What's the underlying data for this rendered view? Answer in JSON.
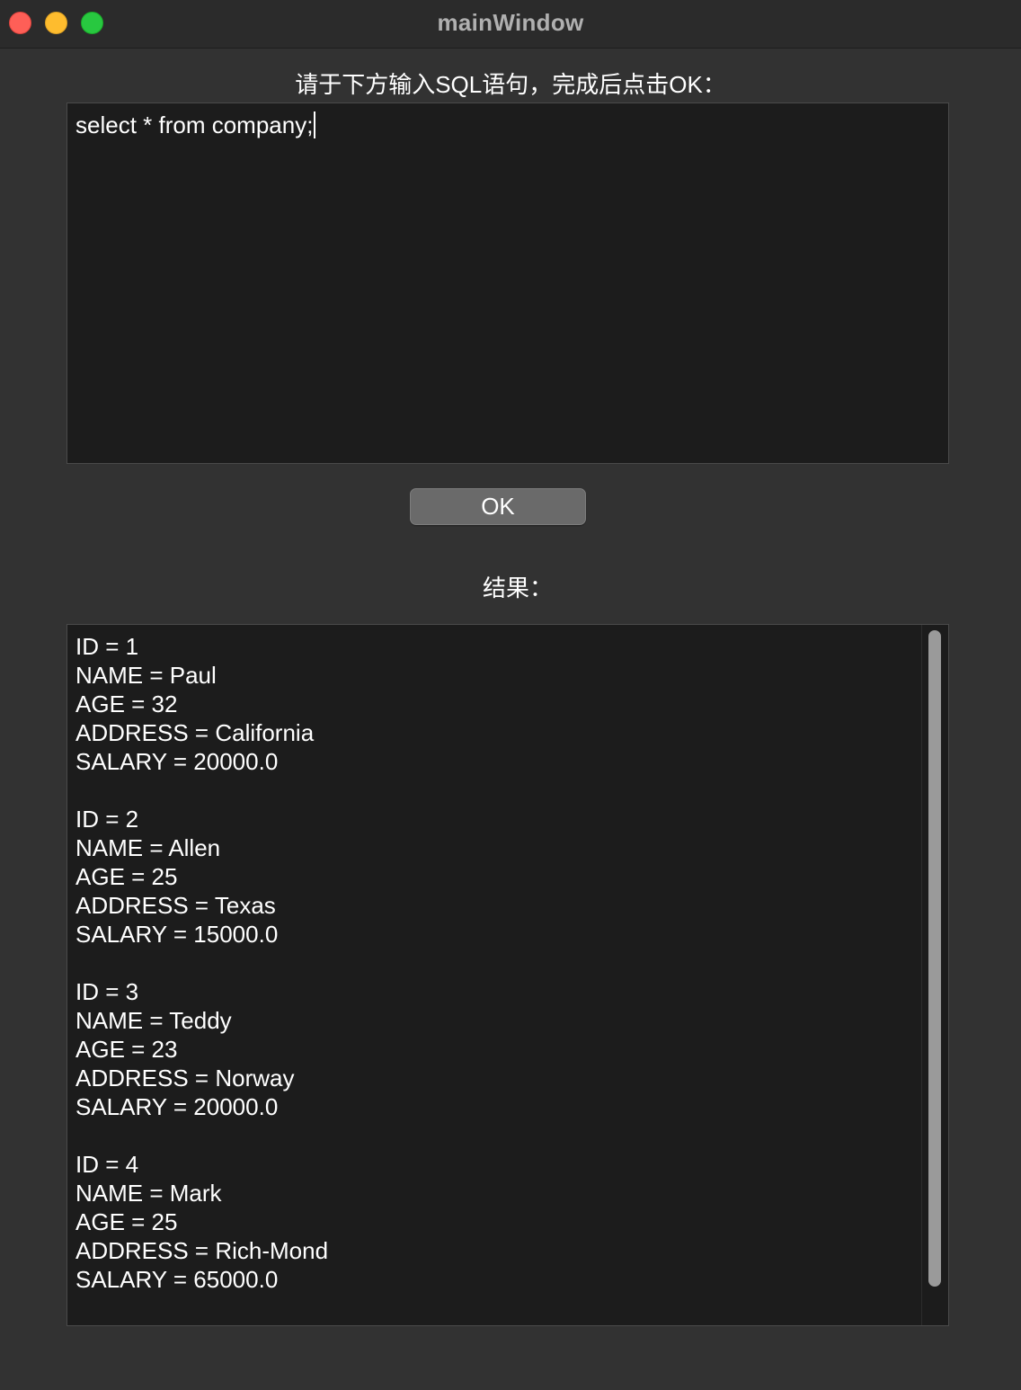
{
  "window": {
    "title": "mainWindow"
  },
  "prompt": {
    "label": "请于下方输入SQL语句，完成后点击OK："
  },
  "sql_editor": {
    "value": "select * from company;"
  },
  "ok_button": {
    "label": "OK"
  },
  "result": {
    "label": "结果：",
    "records": [
      {
        "id": "ID = 1",
        "name": "NAME = Paul",
        "age": "AGE = 32",
        "address": "ADDRESS = California",
        "salary": "SALARY = 20000.0"
      },
      {
        "id": "ID = 2",
        "name": "NAME = Allen",
        "age": "AGE = 25",
        "address": "ADDRESS = Texas",
        "salary": "SALARY = 15000.0"
      },
      {
        "id": "ID = 3",
        "name": "NAME = Teddy",
        "age": "AGE = 23",
        "address": "ADDRESS = Norway",
        "salary": "SALARY = 20000.0"
      },
      {
        "id": "ID = 4",
        "name": "NAME = Mark",
        "age": "AGE = 25",
        "address": "ADDRESS = Rich-Mond",
        "salary": "SALARY = 65000.0"
      }
    ]
  },
  "colors": {
    "close": "#fe5f57",
    "minimize": "#febc2e",
    "maximize": "#28c840",
    "window_bg": "#323232",
    "field_bg": "#1c1c1c",
    "button_bg": "#6a6a6a"
  }
}
